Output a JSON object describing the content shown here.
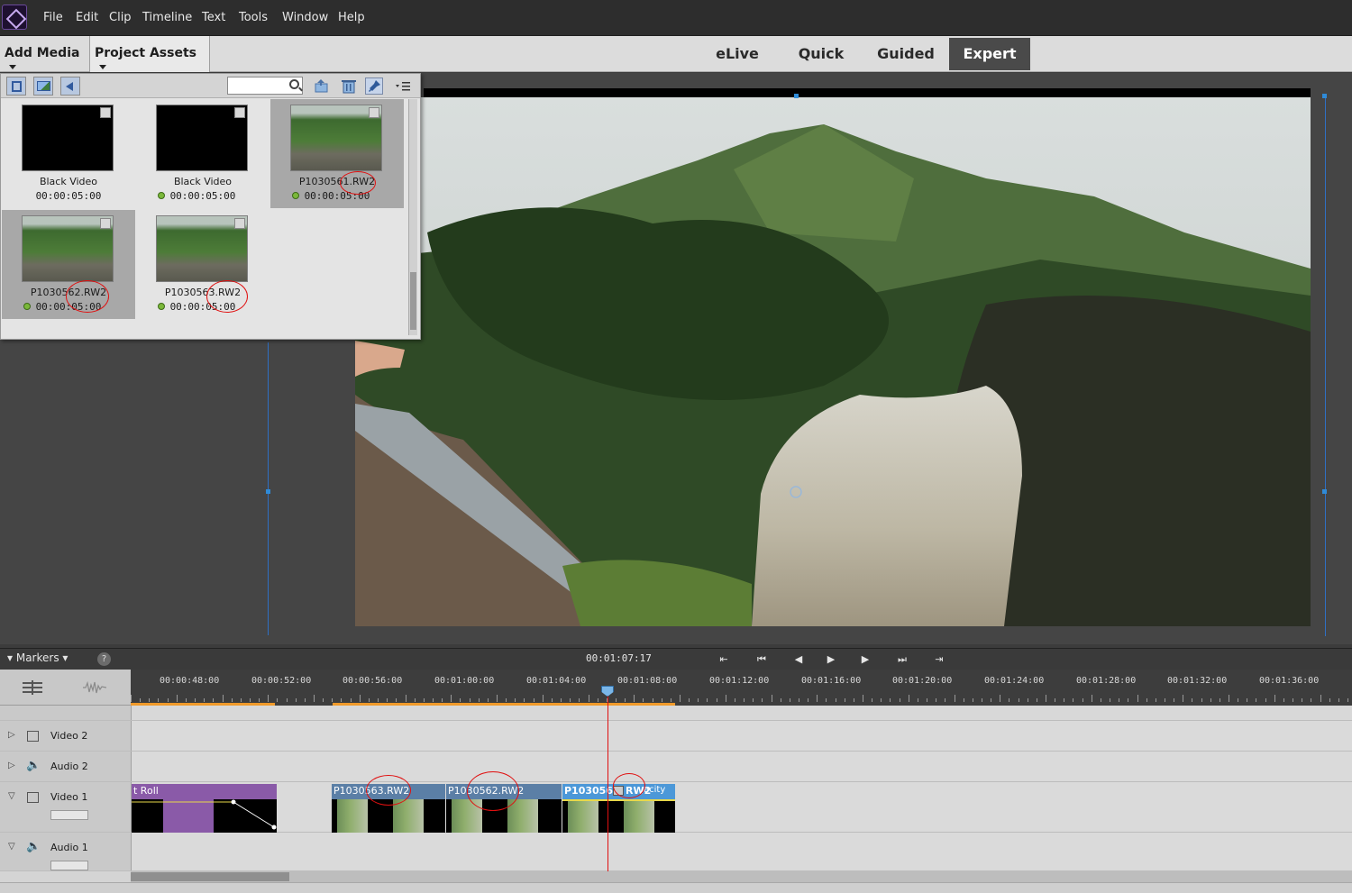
{
  "menu": [
    "File",
    "Edit",
    "Clip",
    "Timeline",
    "Text",
    "Tools",
    "Window",
    "Help"
  ],
  "toolbar": {
    "add_media": "Add Media",
    "project_assets": "Project Assets",
    "modes": [
      "eLive",
      "Quick",
      "Guided",
      "Expert"
    ],
    "active_mode": "Expert"
  },
  "assets": [
    {
      "name": "Black Video",
      "duration": "00:00:05:00",
      "used": false,
      "selected": false,
      "kind": "black"
    },
    {
      "name": "Black Video",
      "duration": "00:00:05:00",
      "used": true,
      "selected": false,
      "kind": "black"
    },
    {
      "name": "P1030561.RW2",
      "duration": "00:00:05:00",
      "used": true,
      "selected": true,
      "kind": "photo"
    },
    {
      "name": "P1030562.RW2",
      "duration": "00:00:05:00",
      "used": true,
      "selected": true,
      "kind": "photo"
    },
    {
      "name": "P1030563.RW2",
      "duration": "00:00:05:00",
      "used": true,
      "selected": false,
      "kind": "photo"
    }
  ],
  "transport": {
    "markers": "Markers",
    "help": "?",
    "timecode": "00:01:07:17"
  },
  "ruler_ticks": [
    "00:00:48:00",
    "00:00:52:00",
    "00:00:56:00",
    "00:01:00:00",
    "00:01:04:00",
    "00:01:08:00",
    "00:01:12:00",
    "00:01:16:00",
    "00:01:20:00",
    "00:01:24:00",
    "00:01:28:00",
    "00:01:32:00",
    "00:01:36:00"
  ],
  "tracks": {
    "video2": "Video 2",
    "audio2": "Audio 2",
    "video1": "Video 1",
    "audio1": "Audio 1"
  },
  "clips": {
    "roll": "t Roll",
    "c1": "P1030563.RW2",
    "c2": "P1030562.RW2",
    "c3": "P103056",
    "c3_suffix": "RW2",
    "c3_menu": "acity"
  },
  "colors": {
    "accent": "#4a4a4a",
    "clip_blue": "#5b7fa6",
    "clip_selected": "#4c98d8",
    "clip_purple": "#8a5aa8",
    "playhead": "#e01010",
    "used_dot": "#7bb83a"
  }
}
